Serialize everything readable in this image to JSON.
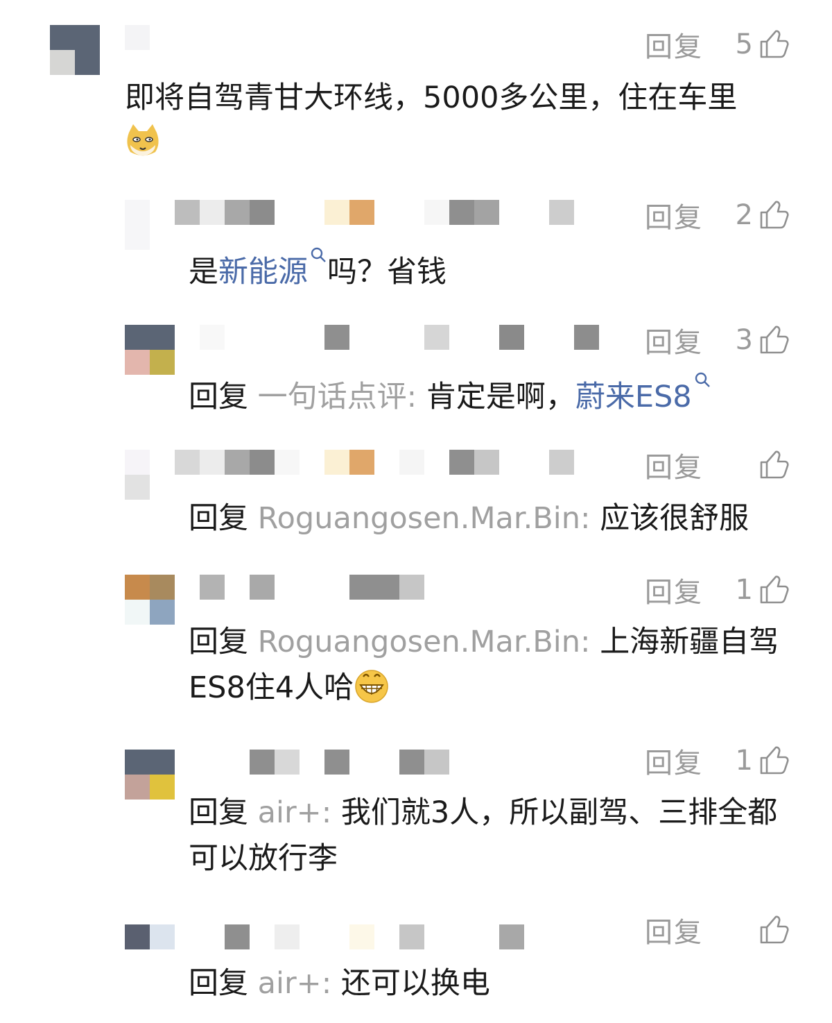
{
  "reply_label": "回复",
  "comments": [
    {
      "likes": "5",
      "text": "即将自驾青甘大环线，5000多公里，住在车里",
      "emoji": "doge-emoji",
      "avatar_colors": [
        "#5b6575",
        "#5b6575",
        "#d6d6d4",
        "#5b6575"
      ]
    },
    {
      "likes": "2",
      "text_before": "是",
      "link": "新能源",
      "text_after": "吗？省钱"
    },
    {
      "likes": "3",
      "reply_prefix": "回复",
      "reply_to": "一句话点评",
      "colon": ":",
      "text_before": "肯定是啊，",
      "link": "蔚来ES8",
      "avatar_colors": [
        "#5b6575",
        "#5b6575",
        "#e3b6ad",
        "#c3b04d"
      ]
    },
    {
      "likes": "",
      "reply_prefix": "回复",
      "reply_to": "Roguangosen.Mar.Bin",
      "colon": ":",
      "text": "应该很舒服"
    },
    {
      "likes": "1",
      "reply_prefix": "回复",
      "reply_to": "Roguangosen.Mar.Bin",
      "colon": ":",
      "text_line1": "上海新疆自驾",
      "text_line2": "ES8住4人哈",
      "emoji": "grin-emoji",
      "avatar_colors": [
        "#c78a4c",
        "#a88a5e",
        "#f1f7f7",
        "#8ea5bf"
      ]
    },
    {
      "likes": "1",
      "reply_prefix": "回复",
      "reply_to": "air+",
      "colon": ":",
      "text_line1": "我们就3人，所以副驾、三排全都",
      "text_line2": "可以放行李",
      "avatar_colors": [
        "#5b6575",
        "#5b6575",
        "#c3a29a",
        "#e0c23d"
      ]
    },
    {
      "likes": "",
      "reply_prefix": "回复",
      "reply_to": "air+",
      "colon": ":",
      "text": "还可以换电",
      "avatar_colors": [
        "#5a6070",
        "#dce4ee",
        "#ffffff",
        "#ffffff"
      ]
    }
  ]
}
